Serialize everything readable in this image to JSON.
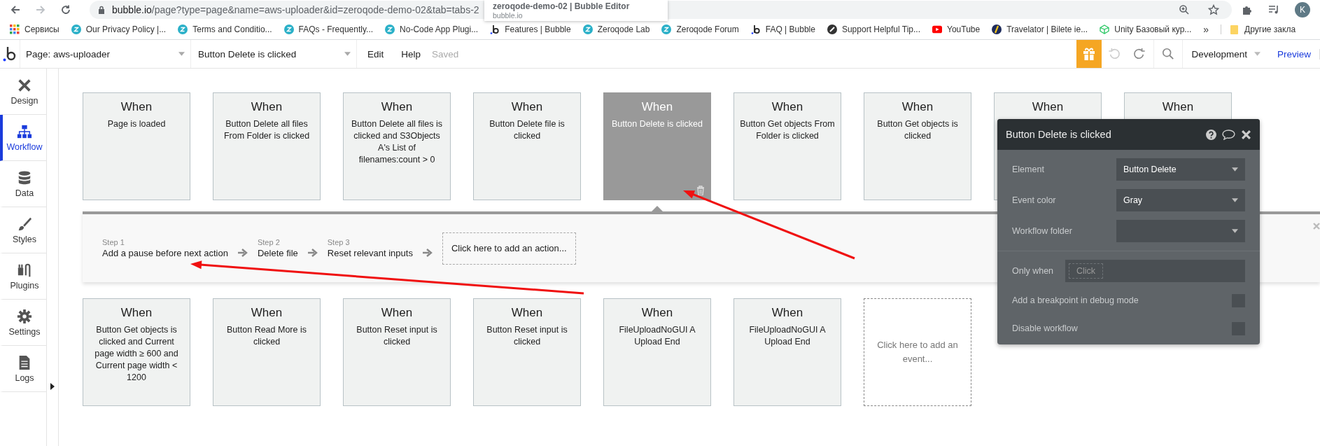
{
  "browser": {
    "url_host": "bubble.io",
    "url_path": "/page?type=page&name=aws-uploader&id=zeroqode-demo-02&tab=tabs-2",
    "tooltip": {
      "title": "zeroqode-demo-02 | Bubble Editor",
      "subtitle": "bubble.io"
    },
    "bookmarks": [
      {
        "label": "Сервисы",
        "kind": "apps"
      },
      {
        "label": "Our Privacy Policy |...",
        "kind": "teal"
      },
      {
        "label": "Terms and Conditio...",
        "kind": "teal"
      },
      {
        "label": "FAQs - Frequently...",
        "kind": "teal"
      },
      {
        "label": "No-Code App Plugi...",
        "kind": "teal"
      },
      {
        "label": "Features | Bubble",
        "kind": "bubble"
      },
      {
        "label": "Zeroqode Lab",
        "kind": "teal"
      },
      {
        "label": "Zeroqode Forum",
        "kind": "teal"
      },
      {
        "label": "FAQ | Bubble",
        "kind": "bubble"
      },
      {
        "label": "Support Helpful Tip...",
        "kind": "dark"
      },
      {
        "label": "YouTube",
        "kind": "video"
      },
      {
        "label": "Travelator | Bilete ie...",
        "kind": "navy"
      },
      {
        "label": "Unity Базовый кур...",
        "kind": "cube"
      }
    ],
    "more": "»",
    "other_bookmarks": "Другие закла",
    "avatar": "K"
  },
  "editor": {
    "page_select": "Page: aws-uploader",
    "event_select": "Button Delete is clicked",
    "menu": [
      "Edit",
      "Help"
    ],
    "save_status": "Saved",
    "environment": "Development",
    "preview": "Preview"
  },
  "sidebar": [
    {
      "label": "Design",
      "kind": "design",
      "selected": false
    },
    {
      "label": "Workflow",
      "kind": "workflow",
      "selected": true
    },
    {
      "label": "Data",
      "kind": "data",
      "selected": false
    },
    {
      "label": "Styles",
      "kind": "styles",
      "selected": false
    },
    {
      "label": "Plugins",
      "kind": "plugins",
      "selected": false
    },
    {
      "label": "Settings",
      "kind": "settings",
      "selected": false
    },
    {
      "label": "Logs",
      "kind": "logs",
      "selected": false
    }
  ],
  "events_row_1": [
    {
      "title": "When",
      "condition": "Page is loaded",
      "selected": false
    },
    {
      "title": "When",
      "condition": "Button Delete all files From Folder is clicked",
      "selected": false
    },
    {
      "title": "When",
      "condition": "Button Delete all files is clicked and S3Objects A's List of filenames:count > 0",
      "selected": false
    },
    {
      "title": "When",
      "condition": "Button Delete file is clicked",
      "selected": false
    },
    {
      "title": "When",
      "condition": "Button Delete is clicked",
      "selected": true
    },
    {
      "title": "When",
      "condition": "Button Get objects From Folder is clicked",
      "selected": false
    },
    {
      "title": "When",
      "condition": "Button Get objects is clicked",
      "selected": false
    },
    {
      "title": "When",
      "selected": false
    },
    {
      "title": "When",
      "selected": false
    }
  ],
  "actions": {
    "steps": [
      {
        "step": "Step 1",
        "name": "Add a pause before next action"
      },
      {
        "step": "Step 2",
        "name": "Delete file"
      },
      {
        "step": "Step 3",
        "name": "Reset relevant inputs"
      }
    ],
    "add_action": "Click here to add an action..."
  },
  "events_row_2": [
    {
      "title": "When",
      "condition": "Button Get objects is clicked and Current page width ≥ 600 and Current page width < 1200"
    },
    {
      "title": "When",
      "condition": "Button Read More is clicked"
    },
    {
      "title": "When",
      "condition": "Button Reset input is clicked"
    },
    {
      "title": "When",
      "condition": "Button Reset input is clicked"
    },
    {
      "title": "When",
      "condition": "FileUploadNoGUI A Upload End"
    },
    {
      "title": "When",
      "condition": "FileUploadNoGUI A Upload End"
    }
  ],
  "add_event": "Click here to add an event...",
  "properties": {
    "title": "Button Delete is clicked",
    "fields": [
      {
        "label": "Element",
        "value": "Button Delete"
      },
      {
        "label": "Event color",
        "value": "Gray"
      },
      {
        "label": "Workflow folder"
      }
    ],
    "only_when": {
      "label": "Only when",
      "placeholder": "Click"
    },
    "options": [
      {
        "label": "Add a breakpoint in debug mode",
        "checked": false
      },
      {
        "label": "Disable workflow",
        "checked": false
      }
    ]
  },
  "annotations": [
    {
      "kind": "arrow"
    },
    {
      "kind": "arrow"
    }
  ]
}
